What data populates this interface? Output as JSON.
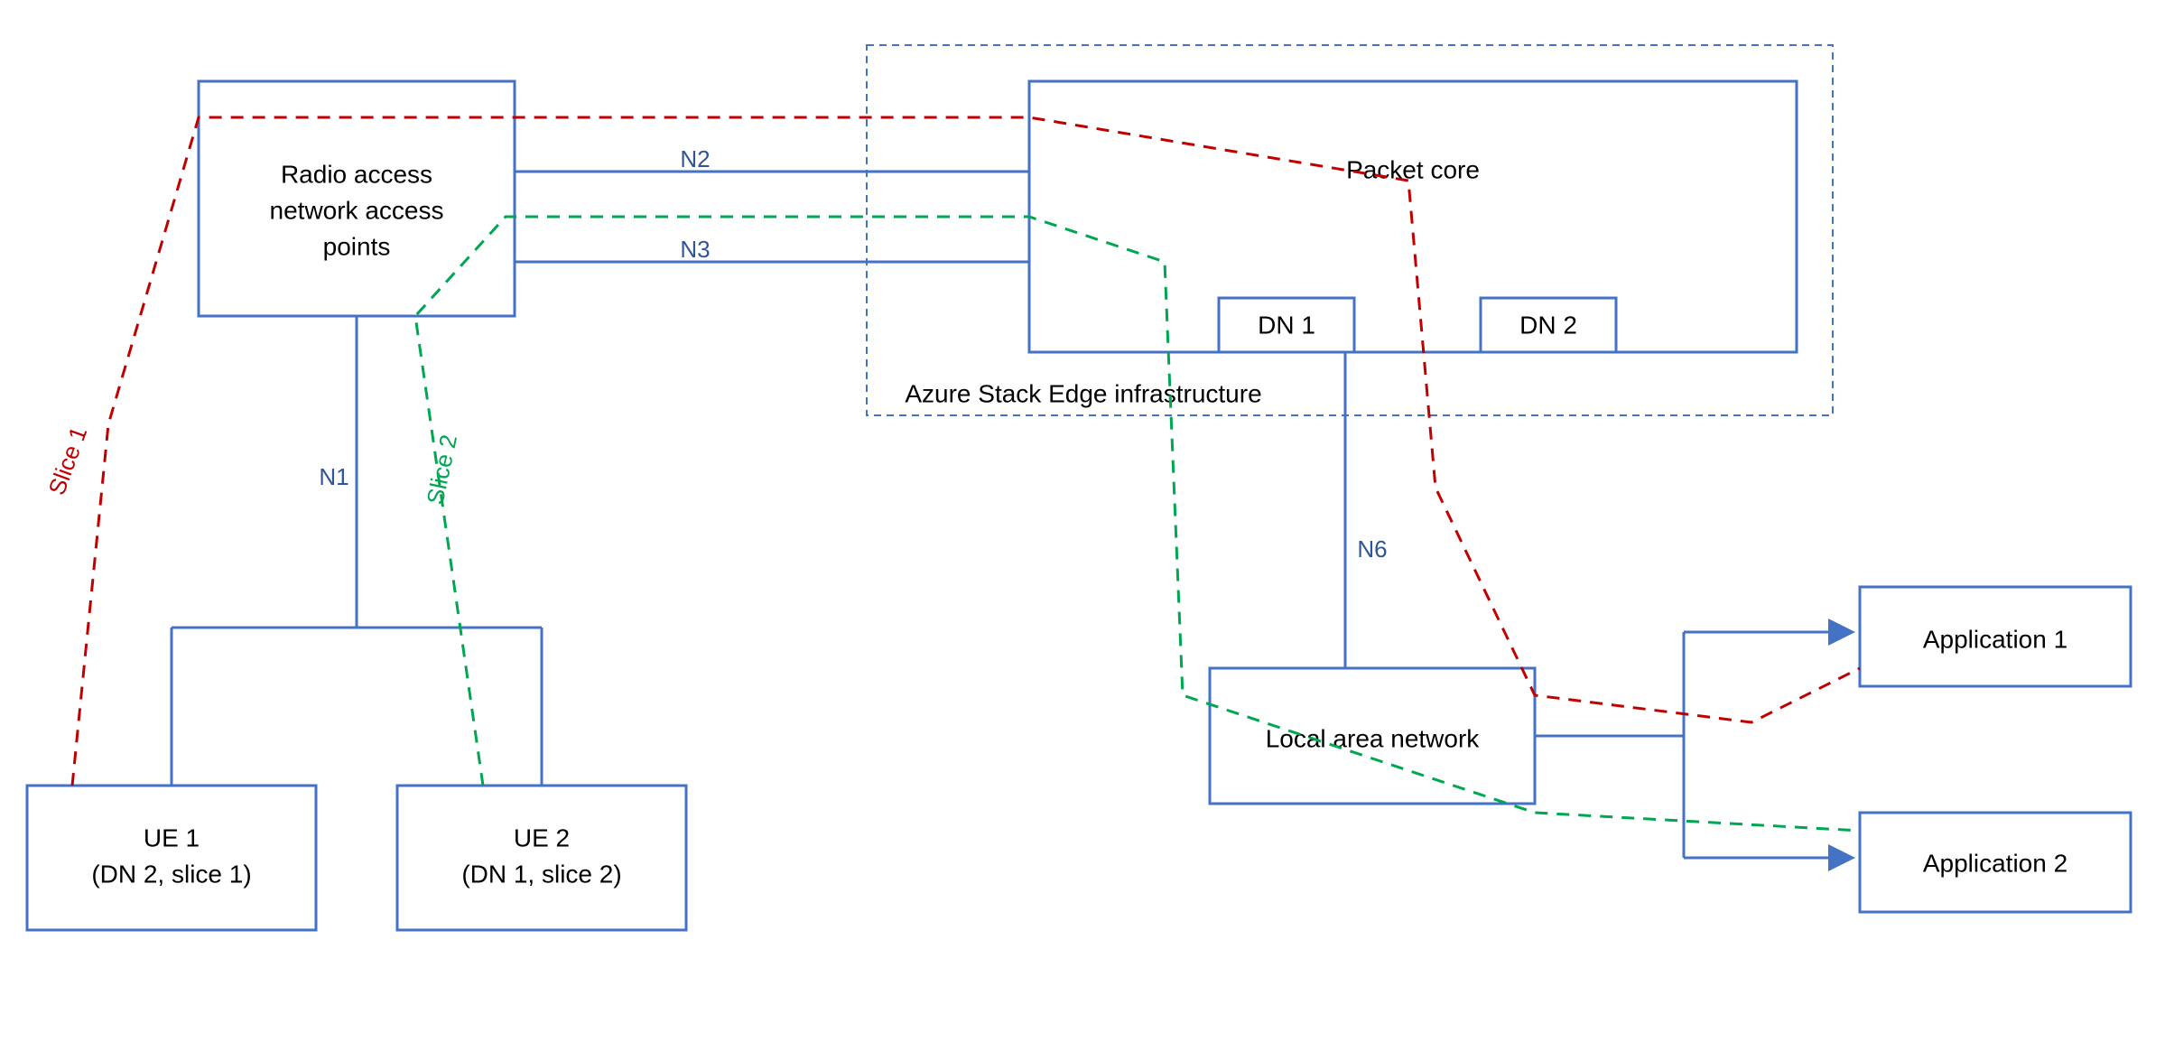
{
  "nodes": {
    "ran": {
      "line1": "Radio access",
      "line2": "network access",
      "line3": "points"
    },
    "packet_core": {
      "label": "Packet core"
    },
    "dn1": {
      "label": "DN 1"
    },
    "dn2": {
      "label": "DN 2"
    },
    "ase": {
      "label": "Azure Stack Edge infrastructure"
    },
    "ue1": {
      "line1": "UE 1",
      "line2": "(DN 2, slice 1)"
    },
    "ue2": {
      "line1": "UE 2",
      "line2": "(DN 1, slice 2)"
    },
    "lan": {
      "label": "Local area network"
    },
    "app1": {
      "label": "Application 1"
    },
    "app2": {
      "label": "Application 2"
    }
  },
  "links": {
    "n1": "N1",
    "n2": "N2",
    "n3": "N3",
    "n6": "N6"
  },
  "slices": {
    "slice1": "Slice 1",
    "slice2": "Slice 2"
  }
}
